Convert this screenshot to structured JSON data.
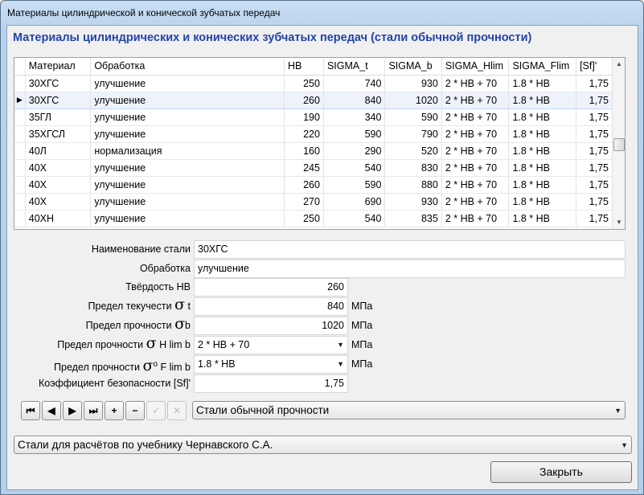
{
  "window": {
    "title": "Материалы цилиндрической и конической зубчатых передач"
  },
  "heading": "Материалы цилиндрических и конических зубчатых передач (стали обычной прочности)",
  "grid": {
    "columns": [
      "Материал",
      "Обработка",
      "HB",
      "SIGMA_t",
      "SIGMA_b",
      "SIGMA_Hlim",
      "SIGMA_Flim",
      "[Sf]'"
    ],
    "rows": [
      [
        "30ХГС",
        "улучшение",
        "250",
        "740",
        "930",
        "2 * HB + 70",
        "1.8 * HB",
        "1,75"
      ],
      [
        "30ХГС",
        "улучшение",
        "260",
        "840",
        "1020",
        "2 * HB + 70",
        "1.8 * HB",
        "1,75"
      ],
      [
        "35ГЛ",
        "улучшение",
        "190",
        "340",
        "590",
        "2 * HB + 70",
        "1.8 * HB",
        "1,75"
      ],
      [
        "35ХГСЛ",
        "улучшение",
        "220",
        "590",
        "790",
        "2 * HB + 70",
        "1.8 * HB",
        "1,75"
      ],
      [
        "40Л",
        "нормализация",
        "160",
        "290",
        "520",
        "2 * HB + 70",
        "1.8 * HB",
        "1,75"
      ],
      [
        "40Х",
        "улучшение",
        "245",
        "540",
        "830",
        "2 * HB + 70",
        "1.8 * HB",
        "1,75"
      ],
      [
        "40Х",
        "улучшение",
        "260",
        "590",
        "880",
        "2 * HB + 70",
        "1.8 * HB",
        "1,75"
      ],
      [
        "40Х",
        "улучшение",
        "270",
        "690",
        "930",
        "2 * HB + 70",
        "1.8 * HB",
        "1,75"
      ],
      [
        "40ХН",
        "улучшение",
        "250",
        "540",
        "835",
        "2 * HB + 70",
        "1.8 * HB",
        "1,75"
      ]
    ],
    "selected_row_index": 1,
    "row_indicator": "▶"
  },
  "form": {
    "steel_name_label": "Наименование стали",
    "steel_name_value": "30ХГС",
    "treatment_label": "Обработка",
    "treatment_value": "улучшение",
    "hardness_label": "Твёрдость HB",
    "hardness_value": "260",
    "yield_label": "Предел текучести",
    "yield_sub": "t",
    "yield_value": "840",
    "strength_label": "Предел прочности",
    "strength_sub": "b",
    "strength_value": "1020",
    "hlim_label": "Предел прочности",
    "hlim_sub": "H lim b",
    "hlim_value": "2 * HB + 70",
    "flim_label": "Предел прочности",
    "flim_sup": "o",
    "flim_sub": "F lim b",
    "flim_value": "1.8 * HB",
    "safety_label": "Коэффициент безопасности [Sf]'",
    "safety_value": "1,75",
    "sigma_symbol": "σ",
    "unit": "МПа"
  },
  "nav": {
    "first": "⏮",
    "prev": "◀",
    "next": "▶",
    "last": "⏭",
    "insert": "+",
    "delete": "−",
    "post": "✓",
    "cancel": "✕",
    "group_select_value": "Стали обычной прочности"
  },
  "source_select_value": "Стали для расчётов по учебнику Чернавского С.А.",
  "close_button": "Закрыть"
}
